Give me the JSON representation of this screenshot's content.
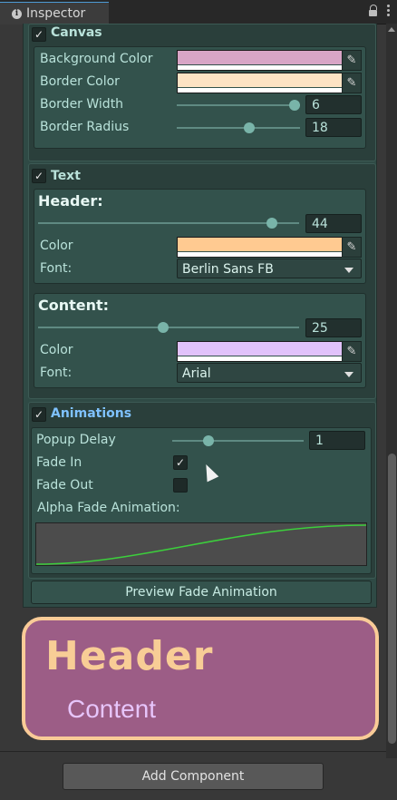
{
  "tab": {
    "title": "Inspector"
  },
  "canvas": {
    "enabled": true,
    "title": "Canvas",
    "background_color": {
      "label": "Background Color",
      "value": "#d8a5c6"
    },
    "border_color": {
      "label": "Border Color",
      "value": "#fde3c4"
    },
    "border_width": {
      "label": "Border Width",
      "value": "6",
      "slider_fraction": 0.94
    },
    "border_radius": {
      "label": "Border Radius",
      "value": "18",
      "slider_fraction": 0.58
    }
  },
  "text": {
    "enabled": true,
    "title": "Text",
    "header": {
      "title": "Header:",
      "size": "44",
      "slider_fraction": 0.88,
      "color_label": "Color",
      "color": "#ffca91",
      "font_label": "Font:",
      "font": "Berlin Sans FB"
    },
    "content": {
      "title": "Content:",
      "size": "25",
      "slider_fraction": 0.47,
      "color_label": "Color",
      "color": "#e1c2fb",
      "font_label": "Font:",
      "font": "Arial"
    }
  },
  "animations": {
    "enabled": true,
    "title": "Animations",
    "popup_delay": {
      "label": "Popup Delay",
      "value": "1",
      "slider_fraction": 0.27
    },
    "fade_in": {
      "label": "Fade In",
      "checked": true
    },
    "fade_out": {
      "label": "Fade Out",
      "checked": false
    },
    "curve_label": "Alpha Fade Animation:",
    "curve_color": "#3ccf3c"
  },
  "preview_button": "Preview Fade Animation",
  "popup_preview": {
    "header": "Header",
    "content": "Content",
    "background": "#9c5d86",
    "border": "#f9cb97"
  },
  "add_component_button": "Add Component"
}
